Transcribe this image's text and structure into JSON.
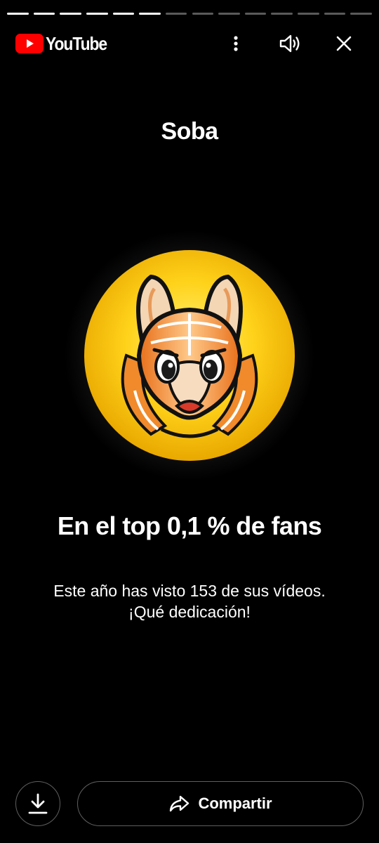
{
  "story": {
    "segments_total": 14,
    "segments_completed": 6
  },
  "header": {
    "brand": "YouTube",
    "brand_color": "#ff0000",
    "menu_icon": "more-vert-icon",
    "sound_icon": "volume-icon",
    "close_icon": "close-icon"
  },
  "card": {
    "channel_name": "Soba",
    "avatar_description_icon": "armadillo-avatar",
    "headline": "En el top 0,1 % de fans",
    "subtitle_line1": "Este año has visto 153 de sus vídeos.",
    "subtitle_line2": "¡Qué dedicación!"
  },
  "actions": {
    "download_icon": "download-icon",
    "share_icon": "share-icon",
    "share_label": "Compartir"
  },
  "colors": {
    "background": "#000000",
    "text": "#ffffff",
    "button_border": "#5f5f5f",
    "avatar_bg": "#f5c400"
  }
}
